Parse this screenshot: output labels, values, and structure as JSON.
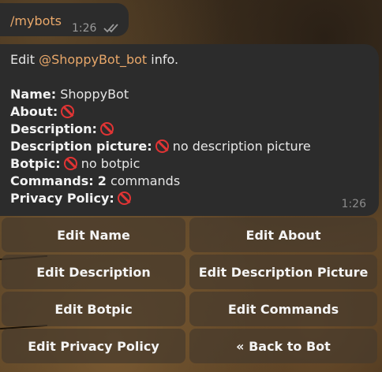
{
  "outgoing": {
    "text": "/mybots",
    "time": "1:26",
    "status_icon": "double-check-read"
  },
  "message": {
    "intro_prefix": "Edit ",
    "intro_mention": "@ShoppyBot_bot",
    "intro_suffix": " info.",
    "fields": {
      "name": {
        "label": "Name:",
        "value": "ShoppyBot"
      },
      "about": {
        "label": "About:"
      },
      "description": {
        "label": "Description:"
      },
      "description_picture": {
        "label": "Description picture:",
        "value": "no description picture"
      },
      "botpic": {
        "label": "Botpic:",
        "value": "no botpic"
      },
      "commands": {
        "label": "Commands:",
        "count": "2",
        "value": "commands"
      },
      "privacy_policy": {
        "label": "Privacy Policy:"
      }
    },
    "time": "1:26"
  },
  "keyboard": {
    "edit_name": "Edit Name",
    "edit_about": "Edit About",
    "edit_description": "Edit Description",
    "edit_description_picture": "Edit Description Picture",
    "edit_botpic": "Edit Botpic",
    "edit_commands": "Edit Commands",
    "edit_privacy_policy": "Edit Privacy Policy",
    "back_to_bot": "« Back to Bot"
  },
  "colors": {
    "mention": "#e9a86a",
    "not_set_icon": "#e03434",
    "bubble": "#2c2c2c"
  }
}
